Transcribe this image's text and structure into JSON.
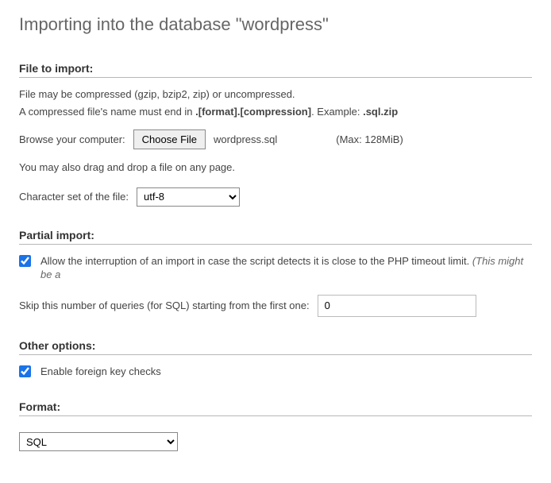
{
  "title": "Importing into the database \"wordpress\"",
  "file_import": {
    "legend": "File to import:",
    "hint1": "File may be compressed (gzip, bzip2, zip) or uncompressed.",
    "hint2_prefix": "A compressed file's name must end in ",
    "hint2_format": ".[format].[compression]",
    "hint2_example_label": ". Example: ",
    "hint2_example": ".sql.zip",
    "browse_label": "Browse your computer:",
    "choose_file_btn": "Choose File",
    "filename": "wordpress.sql",
    "max_size": "(Max: 128MiB)",
    "dragdrop_hint": "You may also drag and drop a file on any page.",
    "charset_label": "Character set of the file:",
    "charset_value": "utf-8"
  },
  "partial_import": {
    "legend": "Partial import:",
    "allow_interrupt_checked": true,
    "allow_interrupt_label": "Allow the interruption of an import in case the script detects it is close to the PHP timeout limit. ",
    "allow_interrupt_note": "(This might be a",
    "skip_label": "Skip this number of queries (for SQL) starting from the first one:",
    "skip_value": "0"
  },
  "other_options": {
    "legend": "Other options:",
    "fk_checked": true,
    "fk_label": "Enable foreign key checks"
  },
  "format": {
    "legend": "Format:",
    "value": "SQL"
  }
}
